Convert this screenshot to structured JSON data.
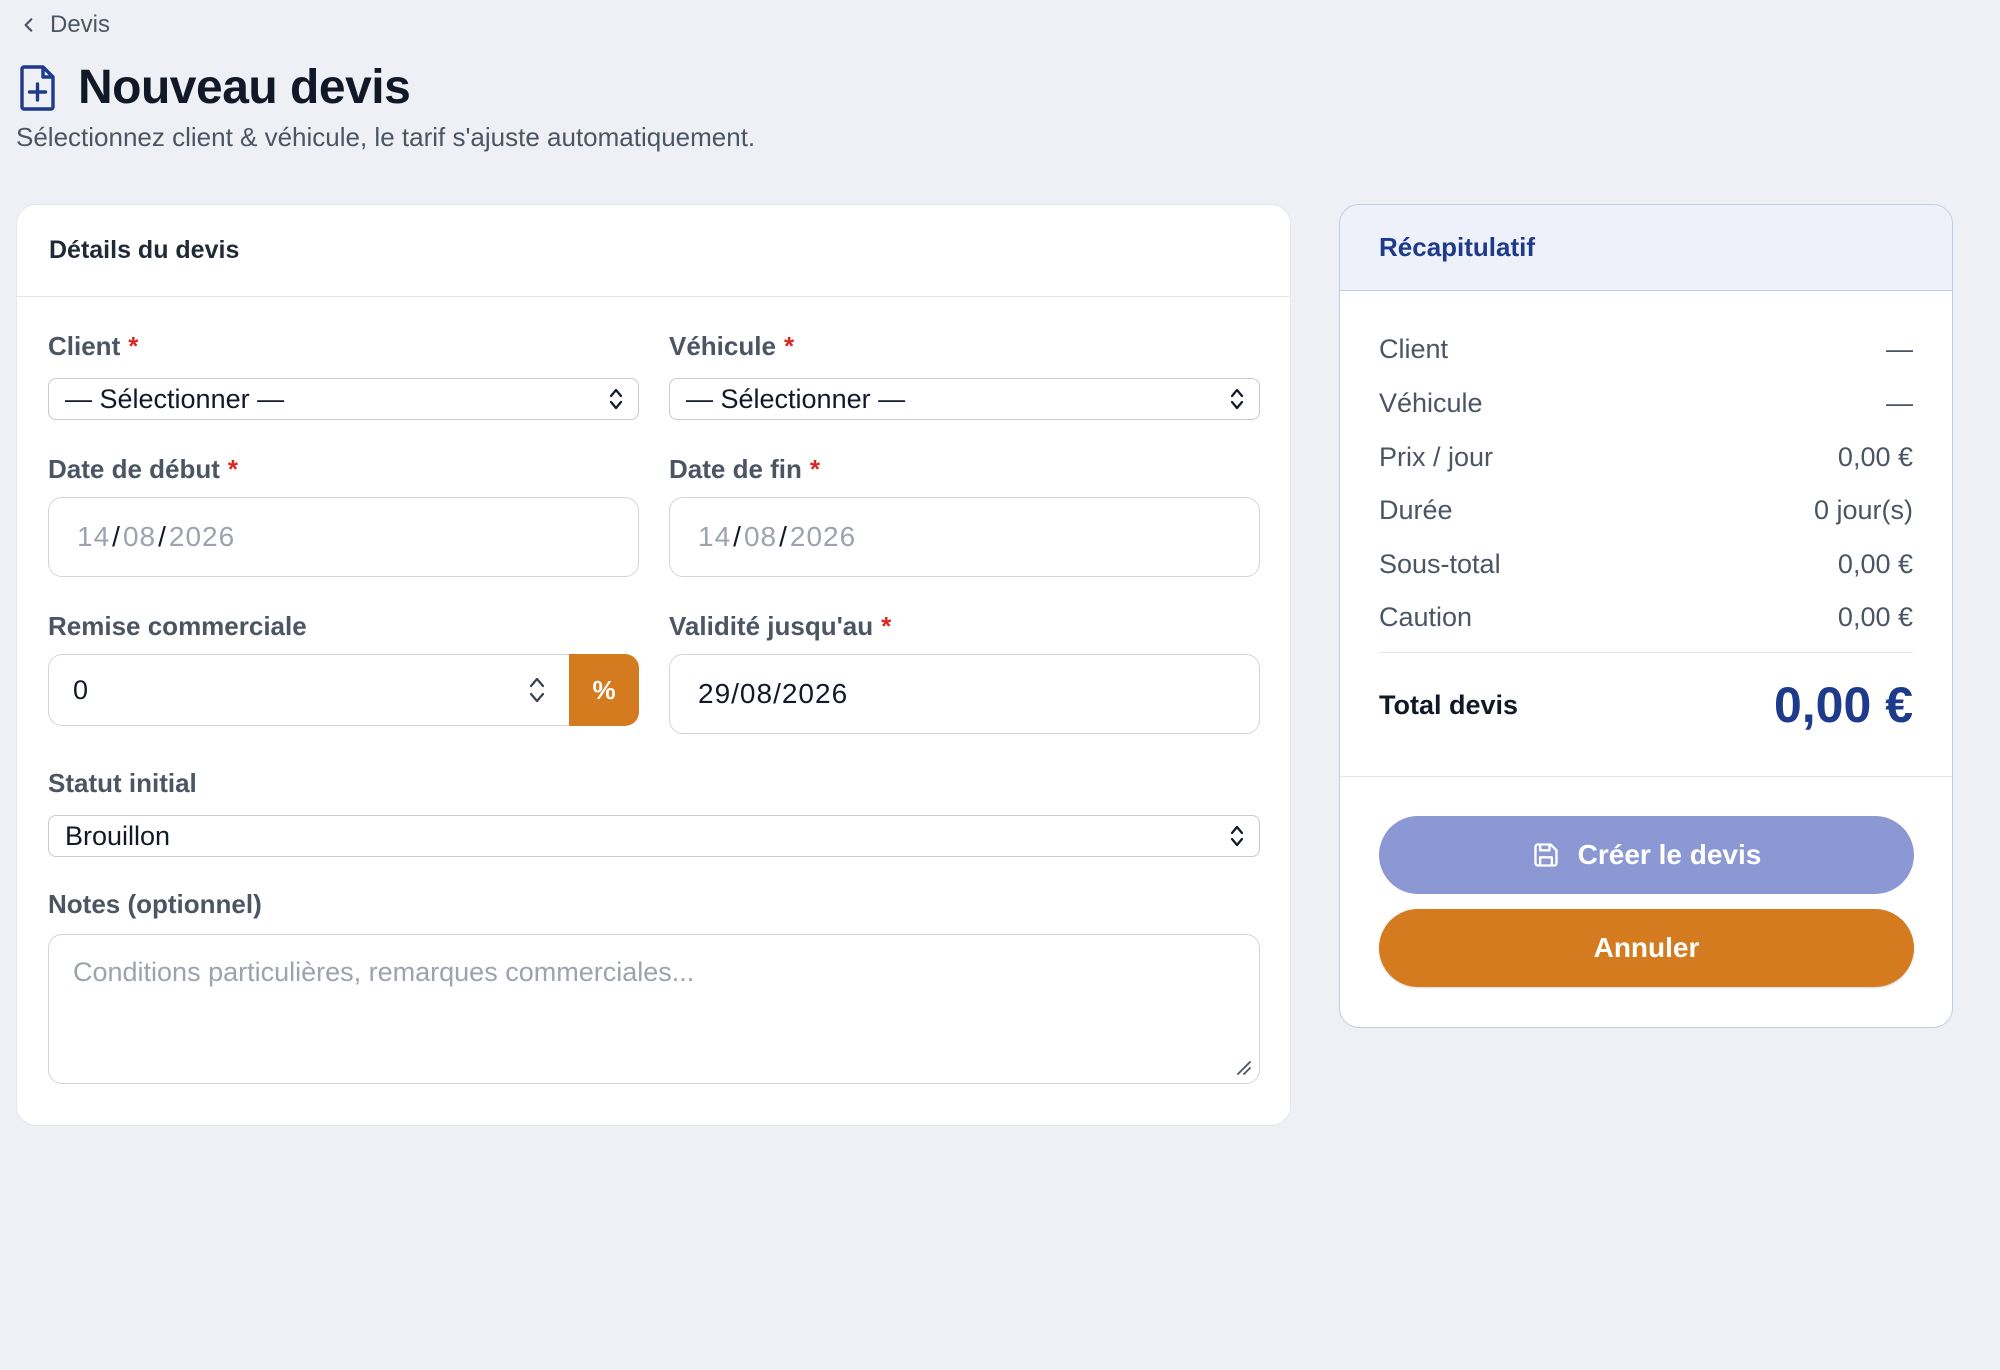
{
  "breadcrumb": {
    "label": "Devis"
  },
  "page": {
    "title": "Nouveau devis",
    "subtitle": "Sélectionnez client & véhicule, le tarif s'ajuste automatiquement."
  },
  "form": {
    "header": "Détails du devis",
    "required_mark": "*",
    "client": {
      "label": "Client",
      "value": "— Sélectionner —"
    },
    "vehicule": {
      "label": "Véhicule",
      "value": "— Sélectionner —"
    },
    "date_debut": {
      "label": "Date de début",
      "day": "14",
      "month": "08",
      "year": "2026",
      "sep": "/"
    },
    "date_fin": {
      "label": "Date de fin",
      "day": "14",
      "month": "08",
      "year": "2026",
      "sep": "/"
    },
    "remise": {
      "label": "Remise commerciale",
      "value": "0",
      "unit_button": "%"
    },
    "validite": {
      "label": "Validité jusqu'au",
      "value": "29/08/2026"
    },
    "statut": {
      "label": "Statut initial",
      "value": "Brouillon"
    },
    "notes": {
      "label": "Notes (optionnel)",
      "placeholder": "Conditions particulières, remarques commerciales..."
    }
  },
  "summary": {
    "header": "Récapitulatif",
    "rows": [
      {
        "label": "Client",
        "value": "—"
      },
      {
        "label": "Véhicule",
        "value": "—"
      },
      {
        "label": "Prix / jour",
        "value": "0,00 €"
      },
      {
        "label": "Durée",
        "value": "0 jour(s)"
      },
      {
        "label": "Sous-total",
        "value": "0,00 €"
      },
      {
        "label": "Caution",
        "value": "0,00 €"
      }
    ],
    "total_label": "Total devis",
    "total_value": "0,00 €",
    "create_button": "Créer le devis",
    "cancel_button": "Annuler"
  },
  "colors": {
    "accent_orange": "#d47b20",
    "brand_blue": "#1e3a8a",
    "create_button_disabled": "#8b98d4",
    "required_red": "#dc2626"
  },
  "icons": {
    "breadcrumb": "chevron-left-icon",
    "title": "file-plus-icon",
    "select": "chevron-up-down-icon",
    "create": "save-icon"
  }
}
